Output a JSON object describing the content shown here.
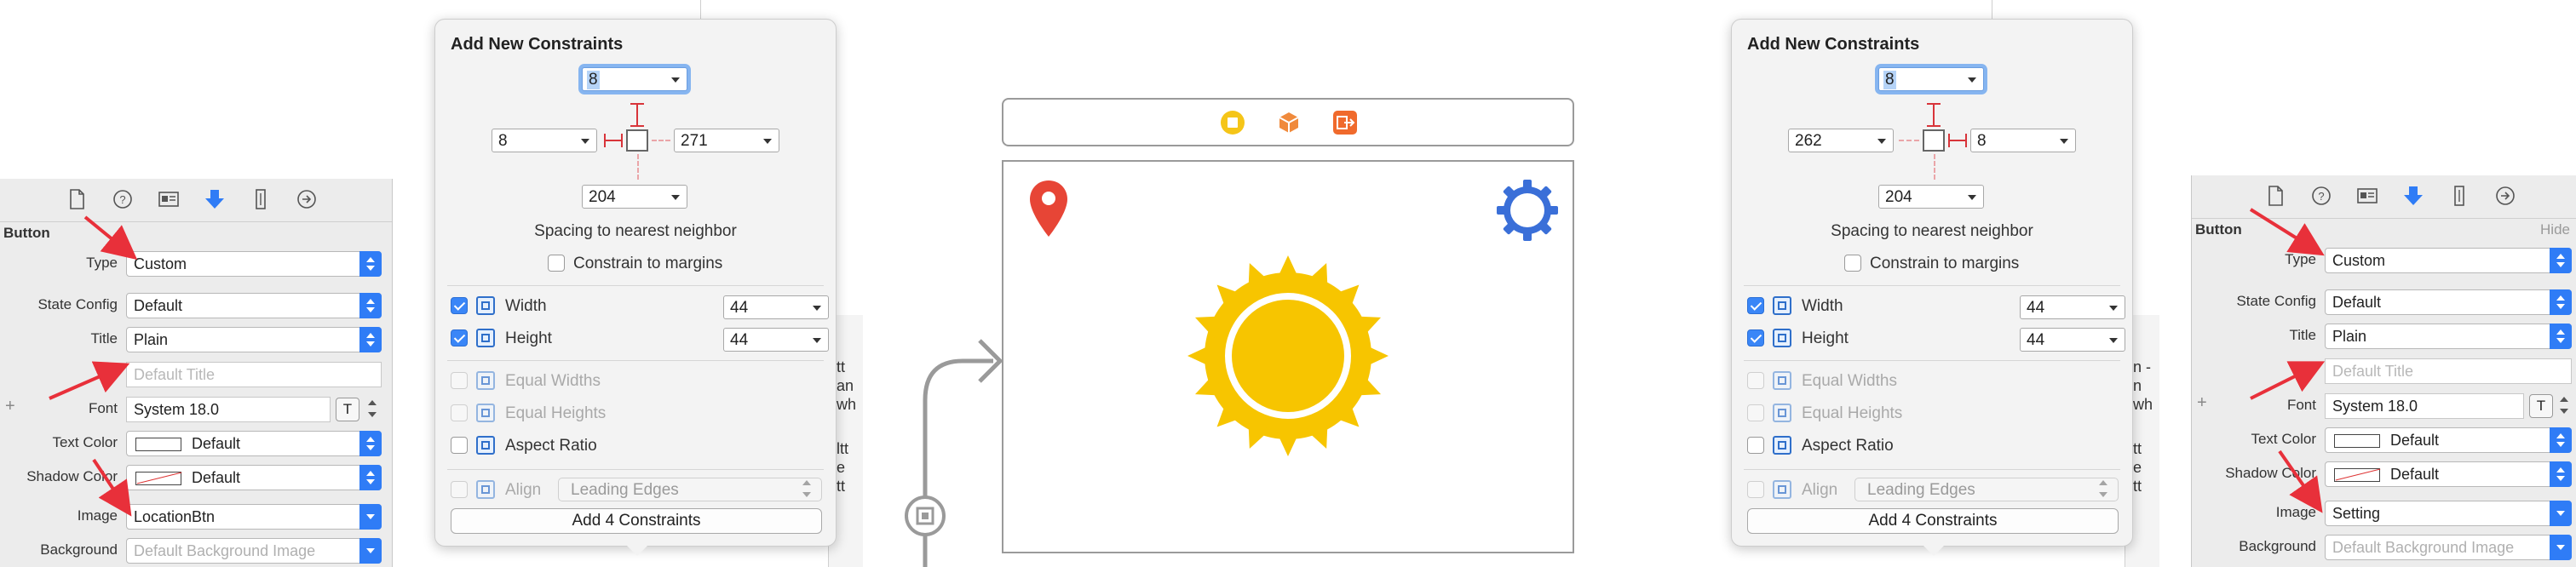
{
  "left_inspector": {
    "title": "Button",
    "rows": {
      "type": {
        "label": "Type",
        "value": "Custom"
      },
      "state_config": {
        "label": "State Config",
        "value": "Default"
      },
      "title": {
        "label": "Title",
        "value": "Plain"
      },
      "default_title": {
        "placeholder": "Default Title"
      },
      "font": {
        "label": "Font",
        "value": "System 18.0"
      },
      "text_color": {
        "label": "Text Color",
        "value": "Default"
      },
      "shadow_color": {
        "label": "Shadow Color",
        "value": "Default"
      },
      "image": {
        "label": "Image",
        "value": "LocationBtn"
      },
      "background": {
        "label": "Background",
        "placeholder": "Default Background Image"
      }
    }
  },
  "right_inspector": {
    "title": "Button",
    "hide_label": "Hide",
    "rows": {
      "type": {
        "label": "Type",
        "value": "Custom"
      },
      "state_config": {
        "label": "State Config",
        "value": "Default"
      },
      "title": {
        "label": "Title",
        "value": "Plain"
      },
      "default_title": {
        "placeholder": "Default Title"
      },
      "font": {
        "label": "Font",
        "value": "System 18.0"
      },
      "text_color": {
        "label": "Text Color",
        "value": "Default"
      },
      "shadow_color": {
        "label": "Shadow Color",
        "value": "Default"
      },
      "image": {
        "label": "Image",
        "value": "Setting"
      },
      "background": {
        "label": "Background",
        "placeholder": "Default Background Image"
      }
    }
  },
  "inspector_icons": [
    "file-icon",
    "help-icon",
    "identity-icon",
    "attributes-icon",
    "size-icon",
    "connections-icon"
  ],
  "font_button_glyph": "T",
  "constraints_left": {
    "title": "Add New Constraints",
    "top": "8",
    "left": "8",
    "right": "271",
    "bottom": "204",
    "spacing_label": "Spacing to nearest neighbor",
    "constrain_margins": "Constrain to margins",
    "width_label": "Width",
    "width_value": "44",
    "height_label": "Height",
    "height_value": "44",
    "equal_widths": "Equal Widths",
    "equal_heights": "Equal Heights",
    "aspect_ratio": "Aspect Ratio",
    "align_label": "Align",
    "align_value": "Leading Edges",
    "add_button": "Add 4 Constraints"
  },
  "constraints_right": {
    "title": "Add New Constraints",
    "top": "8",
    "left": "262",
    "right": "8",
    "bottom": "204",
    "spacing_label": "Spacing to nearest neighbor",
    "constrain_margins": "Constrain to margins",
    "width_label": "Width",
    "width_value": "44",
    "height_label": "Height",
    "height_value": "44",
    "equal_widths": "Equal Widths",
    "equal_heights": "Equal Heights",
    "aspect_ratio": "Aspect Ratio",
    "align_label": "Align",
    "align_value": "Leading Edges",
    "add_button": "Add 4 Constraints"
  },
  "storyboard": {
    "scene_dock_icons": [
      "view-controller-icon",
      "first-responder-icon",
      "exit-icon"
    ],
    "view_icons": [
      "location-pin-icon",
      "settings-gear-icon",
      "sun-icon"
    ]
  },
  "partial_side_text_1": [
    "tt",
    "an",
    "wh",
    "ltt",
    "e",
    "tt"
  ],
  "partial_side_text_2": [
    "n -",
    "n",
    "wh",
    "tt",
    "e",
    "tt"
  ],
  "colors": {
    "accent_blue": "#2f7cf6",
    "annotation_red": "#e8303a",
    "sun_yellow": "#f7c500",
    "pin_red": "#e74536",
    "gear_blue": "#3a6fd8"
  }
}
